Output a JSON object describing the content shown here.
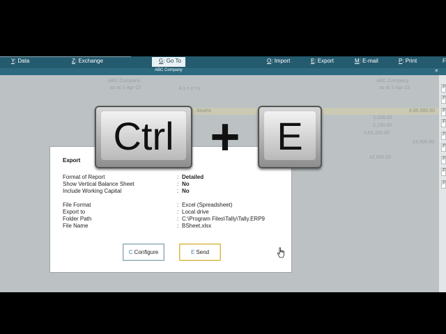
{
  "menu": [
    {
      "key": "Y",
      "label": "Data"
    },
    {
      "key": "Z",
      "label": "Exchange"
    },
    {
      "key": "G",
      "label": "Go To"
    },
    {
      "key": "O",
      "label": "Import"
    },
    {
      "key": "E",
      "label": "Export"
    },
    {
      "key": "M",
      "label": "E-mail"
    },
    {
      "key": "P",
      "label": "Print"
    },
    {
      "key": "F",
      "label": ""
    }
  ],
  "titlebar": {
    "company": "ABC Company",
    "close": "×"
  },
  "background": {
    "company_left": "ABC Company",
    "period_left": "as at 1-Apr-22",
    "heading": "Assets",
    "company_right": "ABC Company",
    "period_right": "as at 1-Apr-22",
    "row_label": "Assets",
    "row_value": "4,85,500.00",
    "val1": "3,100.00",
    "val2": "2,100.00",
    "val3": "3,62,200.00",
    "val4": "14,500.00",
    "val5": "42,000.00"
  },
  "right_panel": [
    "F",
    "F",
    "F",
    "F",
    "F",
    "F",
    "F",
    "F",
    "F"
  ],
  "dialog": {
    "title": "Export",
    "rows": [
      {
        "label": "Format of Report",
        "value": "Detailed"
      },
      {
        "label": "Show Vertical Balance Sheet",
        "value": "No"
      },
      {
        "label": "Include Working Capital",
        "value": "No"
      },
      {
        "label": "File Format",
        "value": "Excel (Spreadsheet)"
      },
      {
        "label": "Export to",
        "value": "Local drive"
      },
      {
        "label": "Folder Path",
        "value": "C:\\Program Files\\Tally\\Tally.ERP9"
      },
      {
        "label": "File Name",
        "value": "BSheet.xlsx"
      }
    ],
    "configure": {
      "key": "C",
      "label": "Configure"
    },
    "send": {
      "key": "E",
      "label": "Send"
    }
  },
  "shortcut": {
    "key1": "Ctrl",
    "plus": "+",
    "key2": "E"
  }
}
